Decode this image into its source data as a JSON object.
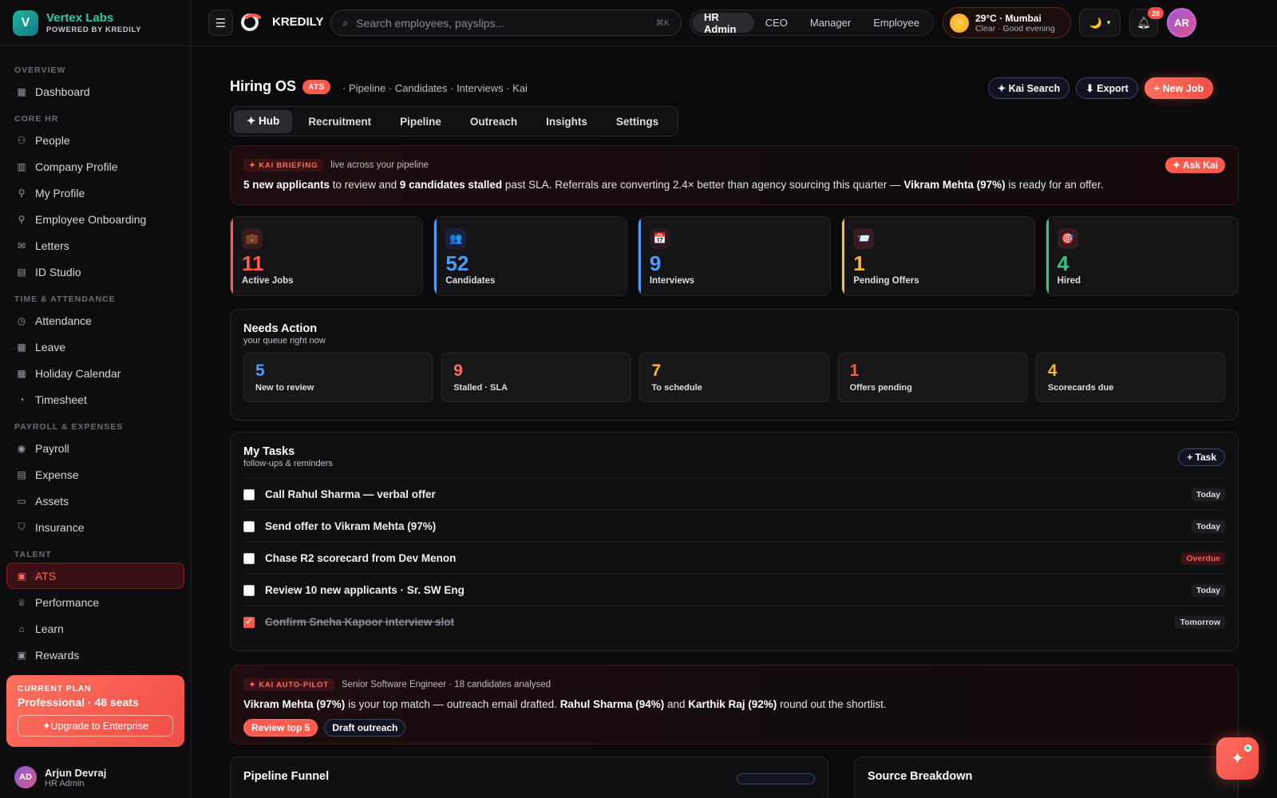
{
  "brand": {
    "logo_letter": "V",
    "name": "Vertex Labs",
    "tagline": "POWERED BY KREDILY"
  },
  "sidebar": {
    "sections": [
      {
        "title": "OVERVIEW",
        "items": [
          {
            "label": "Dashboard",
            "icon": "grid-icon"
          }
        ]
      },
      {
        "title": "CORE HR",
        "items": [
          {
            "label": "People",
            "icon": "users-icon"
          },
          {
            "label": "Company Profile",
            "icon": "building-icon"
          },
          {
            "label": "My Profile",
            "icon": "user-icon"
          },
          {
            "label": "Employee Onboarding",
            "icon": "user-plus-icon"
          },
          {
            "label": "Letters",
            "icon": "mail-icon"
          },
          {
            "label": "ID Studio",
            "icon": "id-card-icon"
          }
        ]
      },
      {
        "title": "TIME & ATTENDANCE",
        "items": [
          {
            "label": "Attendance",
            "icon": "clock-icon"
          },
          {
            "label": "Leave",
            "icon": "calendar-icon"
          },
          {
            "label": "Holiday Calendar",
            "icon": "calendar-icon"
          },
          {
            "label": "Timesheet",
            "icon": "timer-icon"
          }
        ]
      },
      {
        "title": "PAYROLL & EXPENSES",
        "items": [
          {
            "label": "Payroll",
            "icon": "coin-icon"
          },
          {
            "label": "Expense",
            "icon": "receipt-icon"
          },
          {
            "label": "Assets",
            "icon": "monitor-icon"
          },
          {
            "label": "Insurance",
            "icon": "shield-icon"
          }
        ]
      },
      {
        "title": "TALENT",
        "items": [
          {
            "label": "ATS",
            "icon": "clipboard-icon",
            "active": true
          },
          {
            "label": "Performance",
            "icon": "trophy-icon"
          },
          {
            "label": "Learn",
            "icon": "graduation-icon"
          },
          {
            "label": "Rewards",
            "icon": "gift-icon"
          }
        ]
      }
    ],
    "plan": {
      "label": "CURRENT PLAN",
      "name": "Professional · 48 seats",
      "upgrade": "✦Upgrade to Enterprise"
    },
    "user": {
      "initials": "AD",
      "name": "Arjun Devraj",
      "role": "HR Admin"
    }
  },
  "topbar": {
    "menu_icon": "menu-icon",
    "brand": "KREDILY",
    "search_placeholder": "Search employees, payslips...",
    "search_shortcut": "⌘K",
    "roles": [
      "HR Admin",
      "CEO",
      "Manager",
      "Employee"
    ],
    "active_role": "HR Admin",
    "weather": {
      "temp_city": "29°C · Mumbai",
      "status": "Clear · Good evening"
    },
    "theme_icon": "🌙",
    "notifications": "28",
    "avatar": "AR"
  },
  "page": {
    "title": "Hiring OS",
    "badge": "ATS",
    "crumb": "· Pipeline · Candidates · Interviews · Kai",
    "actions": {
      "kai_search": "✦ Kai Search",
      "export": "⬇ Export",
      "new_job": "+ New Job"
    },
    "tabs": [
      "✦ Hub",
      "Recruitment",
      "Pipeline",
      "Outreach",
      "Insights",
      "Settings"
    ],
    "active_tab": "✦ Hub"
  },
  "briefing": {
    "tag": "✦ KAI BRIEFING",
    "live": "live across your pipeline",
    "ask": "✦ Ask Kai",
    "t1": "5 new applicants",
    "t2": " to review and ",
    "t3": "9 candidates stalled",
    "t4": " past SLA. Referrals are converting 2.4× better than agency sourcing this quarter — ",
    "t5": "Vikram Mehta (97%)",
    "t6": " is ready for an offer."
  },
  "stats": [
    {
      "value": "11",
      "label": "Active Jobs",
      "icon": "💼",
      "accent": "#ff5a4e",
      "bg": "#3a1a1a"
    },
    {
      "value": "52",
      "label": "Candidates",
      "icon": "👥",
      "accent": "#4e9bff",
      "bg": "#1a2040"
    },
    {
      "value": "9",
      "label": "Interviews",
      "icon": "📅",
      "accent": "#4e9bff",
      "bg": "#2a1a22"
    },
    {
      "value": "1",
      "label": "Pending Offers",
      "icon": "📨",
      "accent": "#f5b935",
      "bg": "#3a1a22"
    },
    {
      "value": "4",
      "label": "Hired",
      "icon": "🎯",
      "accent": "#2ec98a",
      "bg": "#3a1a22"
    }
  ],
  "needs_action": {
    "title": "Needs Action",
    "subtitle": "your queue right now",
    "items": [
      {
        "value": "5",
        "label": "New to review",
        "color": "#4e9bff"
      },
      {
        "value": "9",
        "label": "Stalled · SLA",
        "color": "#ff6b6b"
      },
      {
        "value": "7",
        "label": "To schedule",
        "color": "#f5b935"
      },
      {
        "value": "1",
        "label": "Offers pending",
        "color": "#ff5a4e"
      },
      {
        "value": "4",
        "label": "Scorecards due",
        "color": "#f5b935"
      }
    ]
  },
  "tasks": {
    "title": "My Tasks",
    "subtitle": "follow-ups & reminders",
    "add": "+ Task",
    "items": [
      {
        "label": "Call Rahul Sharma — verbal offer",
        "due": "Today",
        "done": false,
        "overdue": false
      },
      {
        "label": "Send offer to Vikram Mehta (97%)",
        "due": "Today",
        "done": false,
        "overdue": false
      },
      {
        "label": "Chase R2 scorecard from Dev Menon",
        "due": "Overdue",
        "done": false,
        "overdue": true
      },
      {
        "label": "Review 10 new applicants · Sr. SW Eng",
        "due": "Today",
        "done": false,
        "overdue": false
      },
      {
        "label": "Confirm Sneha Kapoor interview slot",
        "due": "Tomorrow",
        "done": true,
        "overdue": false
      }
    ]
  },
  "autopilot": {
    "tag": "✦ KAI AUTO-PILOT",
    "context": "Senior Software Engineer · 18 candidates analysed",
    "t1": "Vikram Mehta (97%)",
    "t2": " is your top match — outreach email drafted. ",
    "t3": "Rahul Sharma (94%)",
    "t4": " and ",
    "t5": "Karthik Raj (92%)",
    "t6": " round out the shortlist.",
    "btn_review": "Review top 5",
    "btn_draft": "Draft outreach"
  },
  "bottom": {
    "left_title": "Pipeline Funnel",
    "right_title": "Source Breakdown"
  },
  "fab_icon": "✦"
}
